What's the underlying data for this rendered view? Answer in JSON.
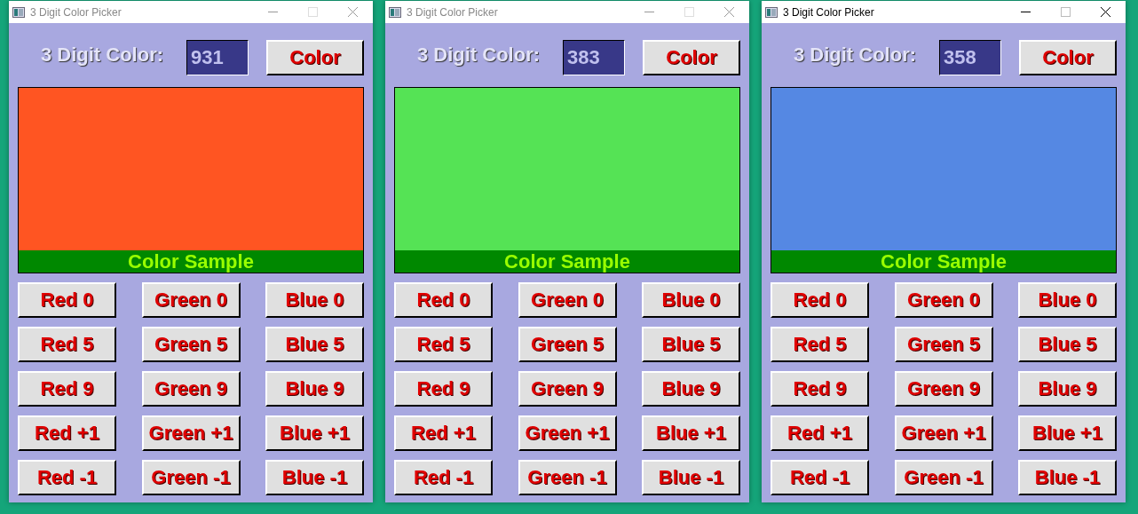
{
  "windows": [
    {
      "title": "3 Digit Color Picker",
      "active": false,
      "label": "3 Digit Color:",
      "value": "931",
      "color_button": "Color",
      "color": "#ff5522",
      "sample_label": "Color Sample",
      "buttons": [
        "Red 0",
        "Green 0",
        "Blue 0",
        "Red 5",
        "Green 5",
        "Blue 5",
        "Red 9",
        "Green 9",
        "Blue 9",
        "Red +1",
        "Green +1",
        "Blue +1",
        "Red -1",
        "Green -1",
        "Blue -1"
      ]
    },
    {
      "title": "3 Digit Color Picker",
      "active": false,
      "label": "3 Digit Color:",
      "value": "383",
      "color_button": "Color",
      "color": "#55e355",
      "sample_label": "Color Sample",
      "buttons": [
        "Red 0",
        "Green 0",
        "Blue 0",
        "Red 5",
        "Green 5",
        "Blue 5",
        "Red 9",
        "Green 9",
        "Blue 9",
        "Red +1",
        "Green +1",
        "Blue +1",
        "Red -1",
        "Green -1",
        "Blue -1"
      ]
    },
    {
      "title": "3 Digit Color Picker",
      "active": true,
      "label": "3 Digit Color:",
      "value": "358",
      "color_button": "Color",
      "color": "#5588e3",
      "sample_label": "Color Sample",
      "buttons": [
        "Red 0",
        "Green 0",
        "Blue 0",
        "Red 5",
        "Green 5",
        "Blue 5",
        "Red 9",
        "Green 9",
        "Blue 9",
        "Red +1",
        "Green +1",
        "Blue +1",
        "Red -1",
        "Green -1",
        "Blue -1"
      ]
    }
  ]
}
